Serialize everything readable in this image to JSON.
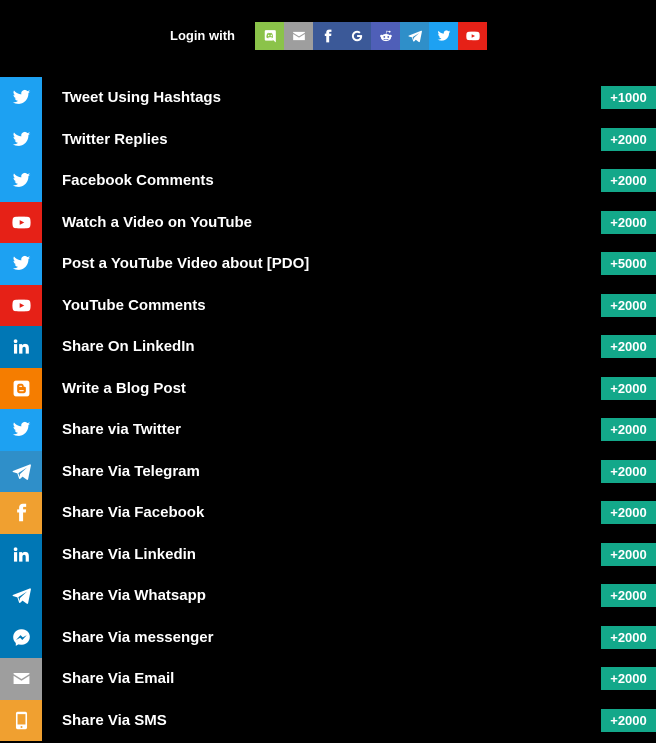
{
  "login": {
    "label": "Login with",
    "buttons": [
      {
        "name": "discord-icon",
        "color": "#8bc34a"
      },
      {
        "name": "envelope-icon",
        "color": "#9e9e9e"
      },
      {
        "name": "facebook-icon",
        "color": "#3b5998"
      },
      {
        "name": "google-icon",
        "color": "#3b5998"
      },
      {
        "name": "reddit-icon",
        "color": "#4f5fb8"
      },
      {
        "name": "telegram-icon",
        "color": "#2f8fc9"
      },
      {
        "name": "twitter-icon",
        "color": "#1da1f2"
      },
      {
        "name": "youtube-icon",
        "color": "#e62117"
      }
    ]
  },
  "entries": [
    {
      "label": "Tweet Using Hashtags",
      "points": "+1000",
      "icon": "twitter-icon",
      "color": "#1da1f2"
    },
    {
      "label": "Twitter Replies",
      "points": "+2000",
      "icon": "twitter-icon",
      "color": "#1da1f2"
    },
    {
      "label": "Facebook Comments",
      "points": "+2000",
      "icon": "twitter-icon",
      "color": "#1da1f2"
    },
    {
      "label": "Watch a Video on YouTube",
      "points": "+2000",
      "icon": "youtube-icon",
      "color": "#e62117"
    },
    {
      "label": "Post a YouTube Video about [PDO]",
      "points": "+5000",
      "icon": "twitter-icon",
      "color": "#1da1f2"
    },
    {
      "label": "YouTube Comments",
      "points": "+2000",
      "icon": "youtube-icon",
      "color": "#e62117"
    },
    {
      "label": "Share On LinkedIn",
      "points": "+2000",
      "icon": "linkedin-icon",
      "color": "#0077b5"
    },
    {
      "label": "Write a Blog Post",
      "points": "+2000",
      "icon": "blogger-icon",
      "color": "#f57d00"
    },
    {
      "label": "Share via Twitter",
      "points": "+2000",
      "icon": "twitter-icon",
      "color": "#1da1f2"
    },
    {
      "label": "Share Via Telegram",
      "points": "+2000",
      "icon": "telegram-icon",
      "color": "#2f8fc9"
    },
    {
      "label": "Share Via Facebook",
      "points": "+2000",
      "icon": "facebook-icon",
      "color": "#f0a030"
    },
    {
      "label": "Share Via Linkedin",
      "points": "+2000",
      "icon": "linkedin-icon",
      "color": "#0077b5"
    },
    {
      "label": "Share Via Whatsapp",
      "points": "+2000",
      "icon": "telegram-icon",
      "color": "#0077b5"
    },
    {
      "label": "Share Via messenger",
      "points": "+2000",
      "icon": "messenger-icon",
      "color": "#0077b5"
    },
    {
      "label": "Share Via Email",
      "points": "+2000",
      "icon": "envelope-icon",
      "color": "#9e9e9e"
    },
    {
      "label": "Share Via SMS",
      "points": "+2000",
      "icon": "mobile-icon",
      "color": "#f0a030"
    }
  ]
}
